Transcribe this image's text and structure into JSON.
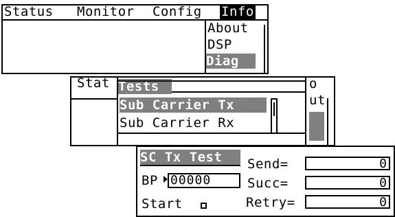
{
  "screen1": {
    "menu": [
      "Status",
      "Monitor",
      "Config",
      "Info"
    ],
    "submenu": [
      "About",
      "DSP",
      "Diag"
    ]
  },
  "screen2": {
    "status_fragment": "Stat",
    "tests_header": "Tests",
    "items": [
      "Sub Carrier Tx",
      "Sub Carrier Rx"
    ],
    "right_fragments": [
      "o",
      "ut"
    ]
  },
  "screen3": {
    "title": "SC Tx Test",
    "bp_label": "BP",
    "bp_value": "00000",
    "start_label": "Start",
    "send_label": "Send=",
    "send_value": "0",
    "succ_label": "Succ=",
    "succ_value": "0",
    "retry_label": "Retry=",
    "retry_value": "0"
  }
}
